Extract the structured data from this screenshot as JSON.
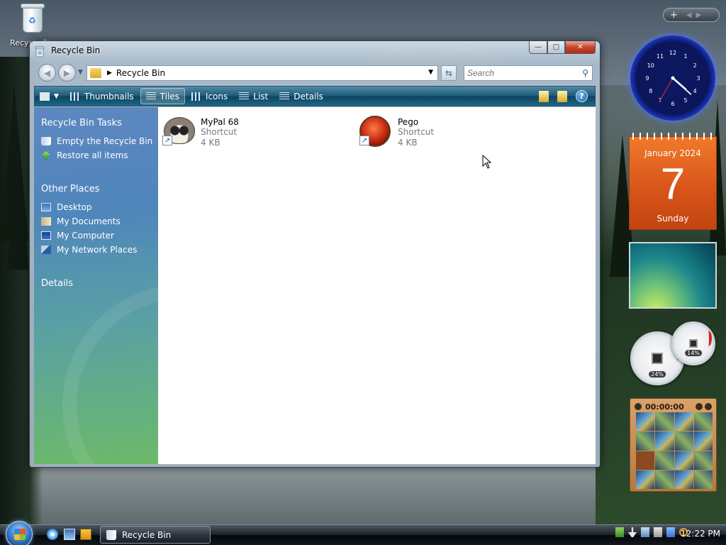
{
  "desktop": {
    "icons": [
      {
        "label": "Recycle Bin"
      }
    ]
  },
  "window": {
    "title": "Recycle Bin",
    "caption": {
      "minimize": "—",
      "maximize": "□",
      "close": "✕"
    },
    "address": {
      "crumb": "Recycle Bin"
    },
    "search": {
      "placeholder": "Search"
    },
    "toolbar": {
      "items": [
        {
          "label": "Thumbnails",
          "active": false
        },
        {
          "label": "Tiles",
          "active": true
        },
        {
          "label": "Icons",
          "active": false
        },
        {
          "label": "List",
          "active": false
        },
        {
          "label": "Details",
          "active": false
        }
      ]
    },
    "sidebar": {
      "tasks_heading": "Recycle Bin Tasks",
      "tasks": [
        {
          "label": "Empty the Recycle Bin",
          "icon": "recycle-bin-icon"
        },
        {
          "label": "Restore all items",
          "icon": "restore-arrow-icon"
        }
      ],
      "places_heading": "Other Places",
      "places": [
        {
          "label": "Desktop",
          "icon": "desktop-icon"
        },
        {
          "label": "My Documents",
          "icon": "documents-icon"
        },
        {
          "label": "My Computer",
          "icon": "computer-icon"
        },
        {
          "label": "My Network Places",
          "icon": "network-icon"
        }
      ],
      "details_heading": "Details"
    },
    "items": [
      {
        "name": "MyPal 68",
        "type": "Shortcut",
        "size": "4 KB",
        "icon": "raccoon-icon"
      },
      {
        "name": "Pego",
        "type": "Shortcut",
        "size": "4 KB",
        "icon": "red-orb-icon"
      }
    ]
  },
  "gadgets": {
    "sidebar_add": "+",
    "clock": {
      "hour": 4,
      "minute": 22,
      "second": 35
    },
    "calendar": {
      "month": "January 2024",
      "day": "7",
      "weekday": "Sunday"
    },
    "meters": {
      "cpu_percent": "24%",
      "memory_percent": "14%"
    },
    "puzzle": {
      "timer": "00:00:00"
    }
  },
  "taskbar": {
    "active_window": "Recycle Bin",
    "time": "12:22 PM"
  },
  "colors": {
    "toolbar": "#1f5a78",
    "sidebar_top": "#5d87c0",
    "sidebar_bottom": "#6cb96a",
    "calendar": "#d9551a"
  }
}
